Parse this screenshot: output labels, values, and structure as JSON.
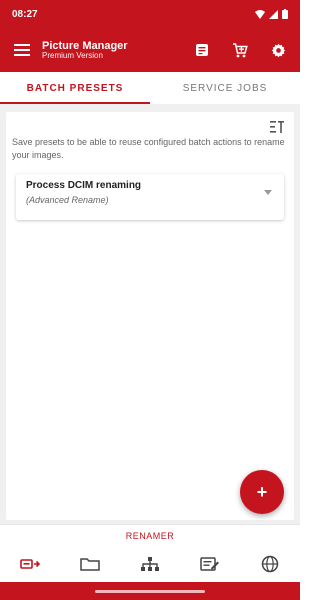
{
  "status_bar": {
    "time": "08:27"
  },
  "app_bar": {
    "title": "Picture Manager",
    "subtitle": "Premium Version"
  },
  "tabs": [
    {
      "label": "BATCH PRESETS",
      "active": true
    },
    {
      "label": "SERVICE JOBS",
      "active": false
    }
  ],
  "content": {
    "info_text": "Save presets to be able to reuse configured batch actions to rename your images.",
    "presets": [
      {
        "name": "Process DCIM renaming",
        "type": "(Advanced Rename)"
      }
    ]
  },
  "fab": {
    "label": "+"
  },
  "bottom_nav": {
    "active_label": "RENAMER",
    "items": [
      {
        "icon": "renamer-icon",
        "active": true
      },
      {
        "icon": "folder-icon",
        "active": false
      },
      {
        "icon": "hierarchy-icon",
        "active": false
      },
      {
        "icon": "edit-list-icon",
        "active": false
      },
      {
        "icon": "globe-icon",
        "active": false
      }
    ]
  },
  "colors": {
    "primary": "#c4141d"
  }
}
